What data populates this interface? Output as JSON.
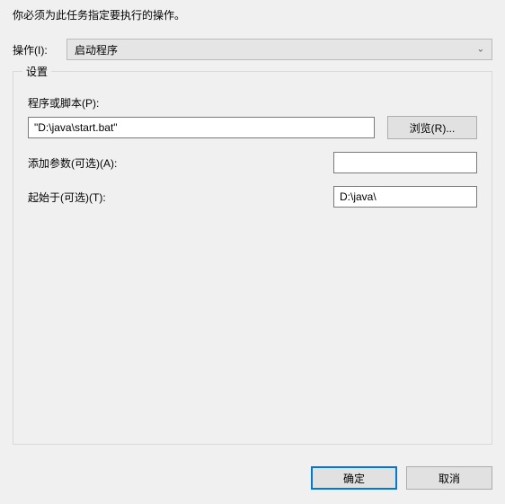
{
  "instruction": "你必须为此任务指定要执行的操作。",
  "action": {
    "label": "操作(I):",
    "selected": "启动程序"
  },
  "settings": {
    "legend": "设置",
    "script_label": "程序或脚本(P):",
    "script_value": "\"D:\\java\\start.bat\"",
    "browse_label": "浏览(R)...",
    "args_label": "添加参数(可选)(A):",
    "args_value": "",
    "startin_label": "起始于(可选)(T):",
    "startin_value": "D:\\java\\"
  },
  "buttons": {
    "ok": "确定",
    "cancel": "取消"
  }
}
